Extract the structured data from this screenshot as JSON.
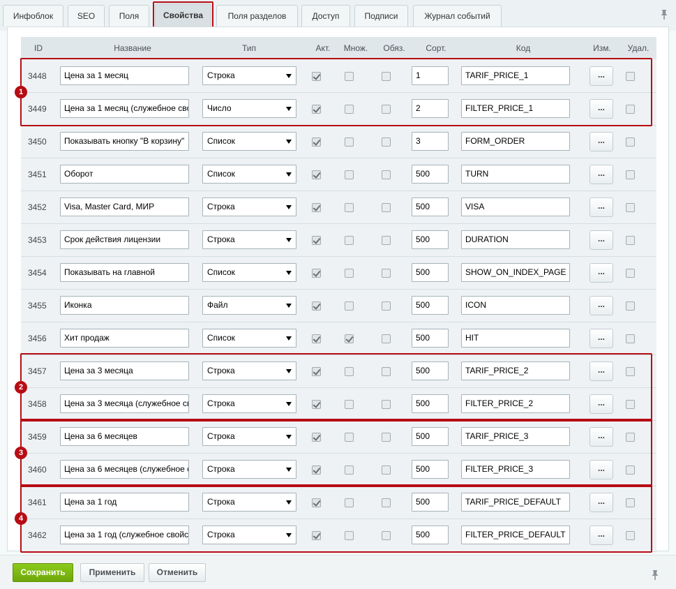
{
  "tabs": [
    {
      "label": "Инфоблок"
    },
    {
      "label": "SEO"
    },
    {
      "label": "Поля"
    },
    {
      "label": "Свойства",
      "active": true
    },
    {
      "label": "Поля разделов"
    },
    {
      "label": "Доступ"
    },
    {
      "label": "Подписи"
    },
    {
      "label": "Журнал событий"
    }
  ],
  "table": {
    "headers": {
      "id": "ID",
      "name": "Название",
      "type": "Тип",
      "active": "Акт.",
      "multiple": "Множ.",
      "required": "Обяз.",
      "sort": "Сорт.",
      "code": "Код",
      "edit": "Изм.",
      "delete": "Удал."
    },
    "rows": [
      {
        "id": "3448",
        "name": "Цена за 1 месяц",
        "type": "Строка",
        "active": true,
        "multiple": false,
        "required": false,
        "sort": "1",
        "code": "TARIF_PRICE_1",
        "edit": "...",
        "delete": false
      },
      {
        "id": "3449",
        "name": "Цена за 1 месяц (служебное сво",
        "type": "Число",
        "active": true,
        "multiple": false,
        "required": false,
        "sort": "2",
        "code": "FILTER_PRICE_1",
        "edit": "...",
        "delete": false
      },
      {
        "id": "3450",
        "name": "Показывать кнопку \"В корзину\"",
        "type": "Список",
        "active": true,
        "multiple": false,
        "required": false,
        "sort": "3",
        "code": "FORM_ORDER",
        "edit": "...",
        "delete": false
      },
      {
        "id": "3451",
        "name": "Оборот",
        "type": "Список",
        "active": true,
        "multiple": false,
        "required": false,
        "sort": "500",
        "code": "TURN",
        "edit": "...",
        "delete": false
      },
      {
        "id": "3452",
        "name": "Visa, Master Card,  МИР",
        "type": "Строка",
        "active": true,
        "multiple": false,
        "required": false,
        "sort": "500",
        "code": "VISA",
        "edit": "...",
        "delete": false
      },
      {
        "id": "3453",
        "name": "Срок действия лицензии",
        "type": "Строка",
        "active": true,
        "multiple": false,
        "required": false,
        "sort": "500",
        "code": "DURATION",
        "edit": "...",
        "delete": false
      },
      {
        "id": "3454",
        "name": "Показывать на главной",
        "type": "Список",
        "active": true,
        "multiple": false,
        "required": false,
        "sort": "500",
        "code": "SHOW_ON_INDEX_PAGE",
        "edit": "...",
        "delete": false
      },
      {
        "id": "3455",
        "name": "Иконка",
        "type": "Файл",
        "active": true,
        "multiple": false,
        "required": false,
        "sort": "500",
        "code": "ICON",
        "edit": "...",
        "delete": false
      },
      {
        "id": "3456",
        "name": "Хит продаж",
        "type": "Список",
        "active": true,
        "multiple": true,
        "required": false,
        "sort": "500",
        "code": "HIT",
        "edit": "...",
        "delete": false
      },
      {
        "id": "3457",
        "name": "Цена за 3 месяца",
        "type": "Строка",
        "active": true,
        "multiple": false,
        "required": false,
        "sort": "500",
        "code": "TARIF_PRICE_2",
        "edit": "...",
        "delete": false
      },
      {
        "id": "3458",
        "name": "Цена за 3 месяца (служебное св",
        "type": "Строка",
        "active": true,
        "multiple": false,
        "required": false,
        "sort": "500",
        "code": "FILTER_PRICE_2",
        "edit": "...",
        "delete": false
      },
      {
        "id": "3459",
        "name": "Цена за 6 месяцев",
        "type": "Строка",
        "active": true,
        "multiple": false,
        "required": false,
        "sort": "500",
        "code": "TARIF_PRICE_3",
        "edit": "...",
        "delete": false
      },
      {
        "id": "3460",
        "name": "Цена за 6 месяцев (служебное с",
        "type": "Строка",
        "active": true,
        "multiple": false,
        "required": false,
        "sort": "500",
        "code": "FILTER_PRICE_3",
        "edit": "...",
        "delete": false
      },
      {
        "id": "3461",
        "name": "Цена за 1 год",
        "type": "Строка",
        "active": true,
        "multiple": false,
        "required": false,
        "sort": "500",
        "code": "TARIF_PRICE_DEFAULT",
        "edit": "...",
        "delete": false
      },
      {
        "id": "3462",
        "name": "Цена за 1 год  (служебное свойс",
        "type": "Строка",
        "active": true,
        "multiple": false,
        "required": false,
        "sort": "500",
        "code": "FILTER_PRICE_DEFAULT",
        "edit": "...",
        "delete": false
      }
    ]
  },
  "annotations": [
    {
      "label": "1",
      "first_row": 0,
      "last_row": 1
    },
    {
      "label": "2",
      "first_row": 9,
      "last_row": 10
    },
    {
      "label": "3",
      "first_row": 11,
      "last_row": 12
    },
    {
      "label": "4",
      "first_row": 13,
      "last_row": 14
    }
  ],
  "footer": {
    "save_label": "Сохранить",
    "apply_label": "Применить",
    "cancel_label": "Отменить"
  },
  "colors": {
    "annotation": "#b70c14",
    "save_button": "#7bb912"
  },
  "icons": {
    "tabs_pin": "pin-icon",
    "footer_pin": "pin-icon"
  }
}
